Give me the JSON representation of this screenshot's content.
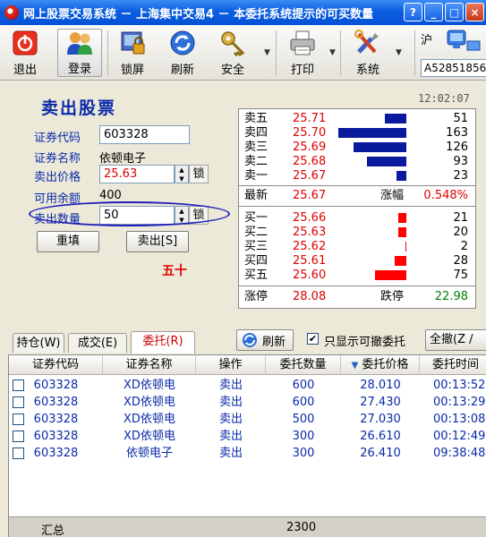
{
  "window": {
    "title": "网上股票交易系统 － 上海集中交易4 － 本委托系统提示的可买数量",
    "buttons": [
      "?",
      "_",
      "□",
      "×"
    ]
  },
  "toolbar": {
    "items": [
      {
        "label": "退出",
        "icon": "exit-icon"
      },
      {
        "label": "登录",
        "icon": "users-icon"
      },
      {
        "label": "锁屏",
        "icon": "lock-icon"
      },
      {
        "label": "刷新",
        "icon": "refresh-icon"
      },
      {
        "label": "安全",
        "icon": "key-icon"
      },
      {
        "label": "打印",
        "icon": "printer-icon"
      },
      {
        "label": "系统",
        "icon": "tools-icon"
      }
    ],
    "market": "沪",
    "account": "A52851856"
  },
  "sell_form": {
    "title": "卖出股票",
    "code_label": "证券代码",
    "code_value": "603328",
    "name_label": "证券名称",
    "name_value": "依顿电子",
    "price_label": "卖出价格",
    "price_value": "25.63",
    "lock_label": "锁",
    "balance_label": "可用余额",
    "balance_value": "400",
    "qty_label": "卖出数量",
    "qty_value": "50",
    "reset_button": "重填",
    "sell_button": "卖出[S]",
    "hint": "五十"
  },
  "quote": {
    "time": "12:02:07",
    "asks": [
      {
        "name": "卖五",
        "price": "25.71",
        "volume": "51"
      },
      {
        "name": "卖四",
        "price": "25.70",
        "volume": "163"
      },
      {
        "name": "卖三",
        "price": "25.69",
        "volume": "126"
      },
      {
        "name": "卖二",
        "price": "25.68",
        "volume": "93"
      },
      {
        "name": "卖一",
        "price": "25.67",
        "volume": "23"
      }
    ],
    "last_label": "最新",
    "last_price": "25.67",
    "change_label": "涨幅",
    "change_value": "0.548%",
    "bids": [
      {
        "name": "买一",
        "price": "25.66",
        "volume": "21"
      },
      {
        "name": "买二",
        "price": "25.63",
        "volume": "20"
      },
      {
        "name": "买三",
        "price": "25.62",
        "volume": "2"
      },
      {
        "name": "买四",
        "price": "25.61",
        "volume": "28"
      },
      {
        "name": "买五",
        "price": "25.60",
        "volume": "75"
      }
    ],
    "limit_up_label": "涨停",
    "limit_up": "28.08",
    "limit_down_label": "跌停",
    "limit_down": "22.98",
    "colors": {
      "ask_bar": "#0a1a9c",
      "bid_bar": "#ff0000",
      "price": "#e00000"
    }
  },
  "tabs": [
    {
      "label": "持仓(W)"
    },
    {
      "label": "成交(E)"
    },
    {
      "label": "委托(R)"
    }
  ],
  "actions": {
    "refresh": "刷新",
    "only_cancelable": "只显示可撤委托",
    "only_cancelable_checked": true,
    "cancel_all": "全撤(Z /"
  },
  "orders": {
    "columns": [
      "证券代码",
      "证券名称",
      "操作",
      "委托数量",
      "委托价格",
      "委托时间"
    ],
    "rows": [
      [
        "603328",
        "XD依顿电",
        "卖出",
        "600",
        "28.010",
        "00:13:52"
      ],
      [
        "603328",
        "XD依顿电",
        "卖出",
        "600",
        "27.430",
        "00:13:29"
      ],
      [
        "603328",
        "XD依顿电",
        "卖出",
        "500",
        "27.030",
        "00:13:08"
      ],
      [
        "603328",
        "XD依顿电",
        "卖出",
        "300",
        "26.610",
        "00:12:49"
      ],
      [
        "603328",
        "依顿电子",
        "卖出",
        "300",
        "26.410",
        "09:38:48"
      ]
    ],
    "summary_label": "汇总",
    "summary_qty": "2300"
  }
}
